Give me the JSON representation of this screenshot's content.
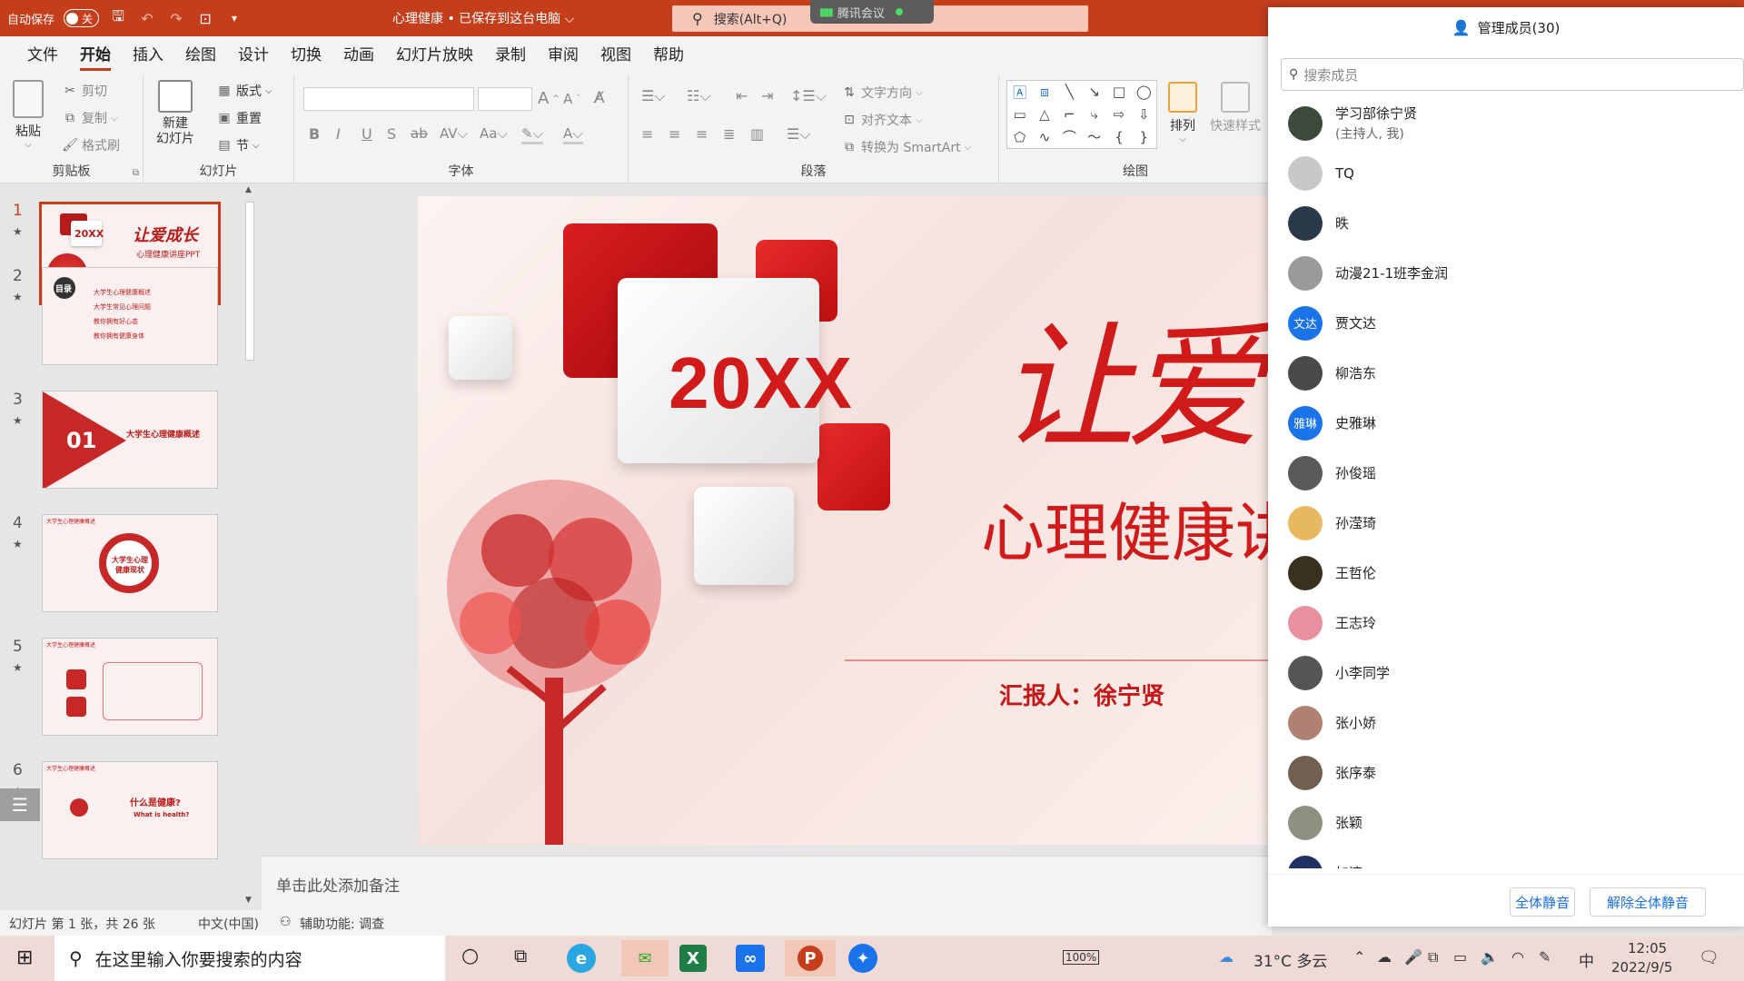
{
  "titlebar": {
    "autosave_label": "自动保存",
    "autosave_state": "关",
    "doc_title": "心理健康 • 已保存到这台电脑 ⌵",
    "search_placeholder": "搜索(Alt+Q)",
    "meeting_label": "腾讯会议"
  },
  "menu": [
    "文件",
    "开始",
    "插入",
    "绘图",
    "设计",
    "切换",
    "动画",
    "幻灯片放映",
    "录制",
    "审阅",
    "视图",
    "帮助"
  ],
  "menu_active": "开始",
  "ribbon": {
    "clipboard": {
      "paste": "粘贴",
      "cut": "剪切",
      "copy": "复制",
      "format_painter": "格式刷",
      "label": "剪贴板"
    },
    "slides": {
      "new_slide": "新建\n幻灯片",
      "layout": "版式",
      "reset": "重置",
      "section": "节",
      "label": "幻灯片"
    },
    "font": {
      "label": "字体"
    },
    "paragraph": {
      "text_direction": "文字方向",
      "align_text": "对齐文本",
      "smartart": "转换为 SmartArt",
      "label": "段落"
    },
    "drawing": {
      "arrange": "排列",
      "quick_styles": "快速样式",
      "label": "绘图"
    }
  },
  "thumbnails": [
    {
      "num": "1",
      "text_a": "20XX",
      "text_b": "让爱成长",
      "text_c": "心理健康讲座PPT"
    },
    {
      "num": "2",
      "text_a": "目录",
      "items": [
        "大学生心理健康概述",
        "大学生常见心理问题",
        "教你拥有好心态",
        "教你拥有健康身体"
      ]
    },
    {
      "num": "3",
      "text_a": "01",
      "text_b": "大学生心理健康概述"
    },
    {
      "num": "4",
      "text_a": "大学生心理健康概述",
      "text_b": "大学生心理健康现状"
    },
    {
      "num": "5",
      "text_a": "大学生心理健康概述"
    },
    {
      "num": "6",
      "text_a": "大学生心理健康概述",
      "text_b": "什么是健康?",
      "text_c": "What is health?"
    }
  ],
  "slide": {
    "year": "20XX",
    "calligraphy_title": "让爱",
    "subtitle": "心理健康讲",
    "reporter": "汇报人：徐宁贤"
  },
  "notes_placeholder": "单击此处添加备注",
  "status": {
    "slide_info": "幻灯片 第 1 张，共 26 张",
    "language": "中文(中国)",
    "accessibility": "辅助功能: 调查"
  },
  "member_panel": {
    "title": "管理成员(30)",
    "search_placeholder": "搜索成员",
    "members": [
      {
        "name": "学习部徐宁贤",
        "role": "(主持人, 我)",
        "avatar_color": "#3b4a3a",
        "avatar_text": ""
      },
      {
        "name": "TQ",
        "role": "",
        "avatar_color": "#c8c8c8",
        "avatar_text": ""
      },
      {
        "name": "昳",
        "role": "",
        "avatar_color": "#2a3a4a",
        "avatar_text": ""
      },
      {
        "name": "动漫21-1班李金润",
        "role": "",
        "avatar_color": "#9a9a9a",
        "avatar_text": ""
      },
      {
        "name": "贾文达",
        "role": "",
        "avatar_color": "#1a73e8",
        "avatar_text": "文达"
      },
      {
        "name": "柳浩东",
        "role": "",
        "avatar_color": "#4a4a4a",
        "avatar_text": ""
      },
      {
        "name": "史雅琳",
        "role": "",
        "avatar_color": "#1a73e8",
        "avatar_text": "雅琳"
      },
      {
        "name": "孙俊瑶",
        "role": "",
        "avatar_color": "#5a5a5a",
        "avatar_text": ""
      },
      {
        "name": "孙滢琦",
        "role": "",
        "avatar_color": "#e8b860",
        "avatar_text": ""
      },
      {
        "name": "王哲伦",
        "role": "",
        "avatar_color": "#3a3020",
        "avatar_text": ""
      },
      {
        "name": "王志玲",
        "role": "",
        "avatar_color": "#e890a0",
        "avatar_text": ""
      },
      {
        "name": "小李同学",
        "role": "",
        "avatar_color": "#555555",
        "avatar_text": ""
      },
      {
        "name": "张小娇",
        "role": "",
        "avatar_color": "#b08070",
        "avatar_text": ""
      },
      {
        "name": "张序泰",
        "role": "",
        "avatar_color": "#706050",
        "avatar_text": ""
      },
      {
        "name": "张颖",
        "role": "",
        "avatar_color": "#909080",
        "avatar_text": ""
      },
      {
        "name": "加速",
        "role": "",
        "avatar_color": "#203060",
        "avatar_text": ""
      }
    ],
    "mute_all": "全体静音",
    "unmute_all": "解除全体静音"
  },
  "taskbar": {
    "search_placeholder": "在这里输入你要搜索的内容",
    "battery": "100%",
    "weather": "31°C 多云",
    "ime": "中",
    "time": "12:05",
    "date": "2022/9/5"
  },
  "colors": {
    "accent": "#c43e1c",
    "slide_red": "#d11a1a",
    "link_blue": "#1a6fe0"
  }
}
